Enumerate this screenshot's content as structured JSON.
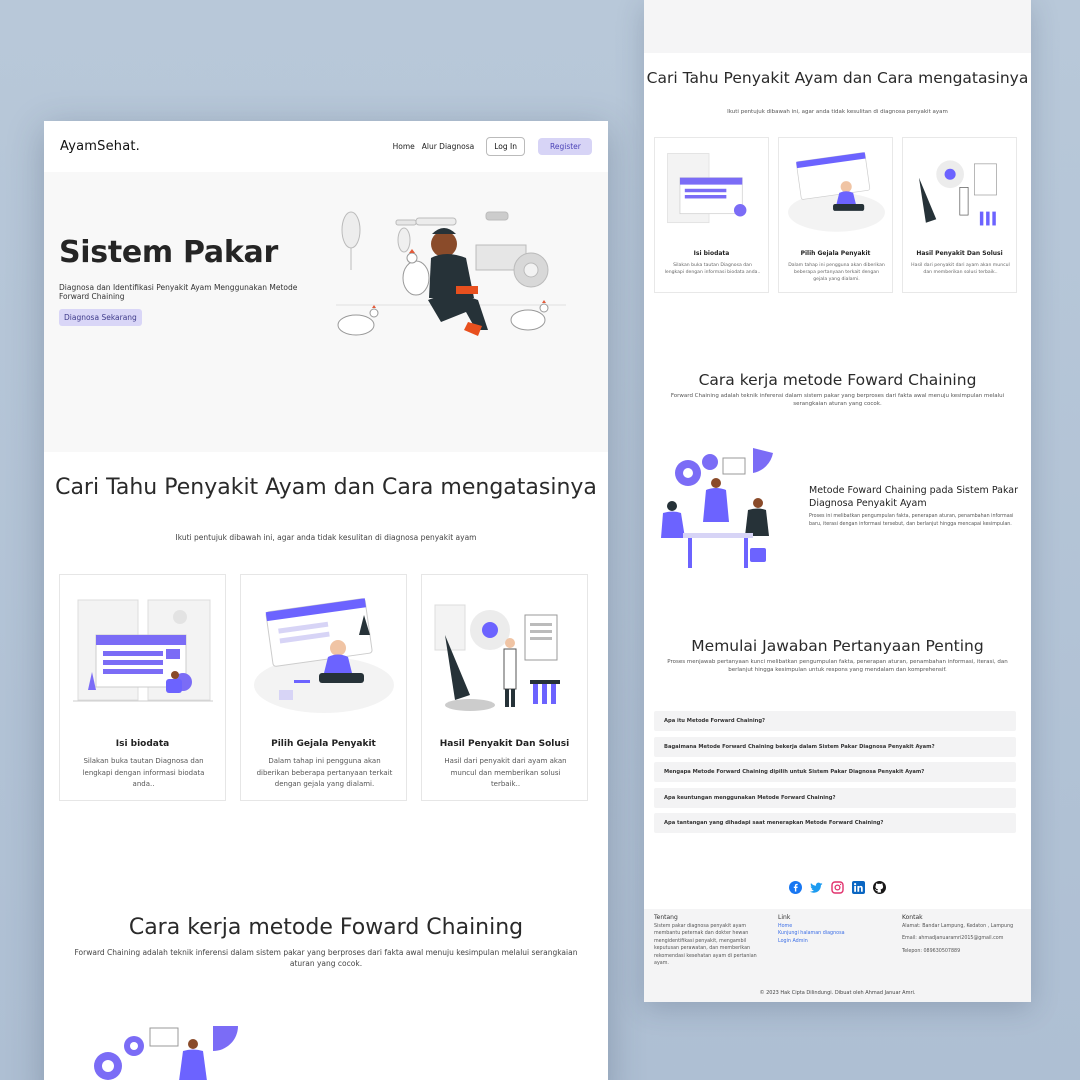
{
  "nav": {
    "brand": "AyamSehat.",
    "home": "Home",
    "alur": "Alur Diagnosa",
    "login": "Log In",
    "register": "Register"
  },
  "hero": {
    "title": "Sistem Pakar",
    "description": "Diagnosa dan Identifikasi Penyakit Ayam Menggunakan Metode Forward Chaining",
    "cta": "Diagnosa Sekarang"
  },
  "steps": {
    "title": "Cari Tahu Penyakit Ayam dan Cara mengatasinya",
    "subtitle": "Ikuti pentujuk dibawah ini, agar anda tidak kesulitan di diagnosa penyakit ayam",
    "cards": [
      {
        "title": "Isi biodata",
        "desc": "Silakan buka tautan Diagnosa dan lengkapi dengan informasi biodata anda.."
      },
      {
        "title": "Pilih Gejala Penyakit",
        "desc": "Dalam tahap ini pengguna akan diberikan beberapa pertanyaan terkait dengan gejala yang dialami."
      },
      {
        "title": "Hasil Penyakit Dan Solusi",
        "desc": "Hasil dari penyakit dari ayam akan muncul dan memberikan solusi terbaik.."
      }
    ]
  },
  "method": {
    "title": "Cara kerja metode Foward Chaining",
    "subtitle": "Forward Chaining adalah teknik inferensi dalam sistem pakar yang berproses dari fakta awal menuju kesimpulan melalui serangkaian aturan yang cocok.",
    "feature_title": "Metode Foward Chaining pada Sistem Pakar Diagnosa Penyakit Ayam",
    "feature_desc": "Proses ini melibatkan pengumpulan fakta, penerapan aturan, penambahan informasi baru, iterasi dengan informasi tersebut, dan berlanjut hingga mencapai kesimpulan."
  },
  "faq": {
    "title": "Memulai Jawaban Pertanyaan Penting",
    "subtitle": "Proses menjawab pertanyaan kunci melibatkan pengumpulan fakta, penerapan aturan, penambahan informasi, iterasi, dan berlanjut hingga kesimpulan untuk respons yang mendalam dan komprehensif.",
    "items": [
      "Apa itu Metode Forward Chaining?",
      "Bagaimana Metode Forward Chaining bekerja dalam Sistem Pakar Diagnosa Penyakit Ayam?",
      "Mengapa Metode Forward Chaining dipilih untuk Sistem Pakar Diagnosa Penyakit Ayam?",
      "Apa keuntungan menggunakan Metode Forward Chaining?",
      "Apa tantangan yang dihadapi saat menerapkan Metode Forward Chaining?"
    ]
  },
  "socials": [
    "facebook-icon",
    "twitter-icon",
    "instagram-icon",
    "linkedin-icon",
    "github-icon"
  ],
  "footer": {
    "about_head": "Tentang",
    "about_text": "Sistem pakar diagnosa penyakit ayam membantu peternak dan dokter hewan mengidentifikasi penyakit, mengambil keputusan perawatan, dan memberikan rekomendasi kesehatan ayam di pertanian ayam.",
    "link_head": "Link",
    "links": [
      "Home",
      "Kunjungi halaman diagnosa",
      "Login Admin"
    ],
    "contact_head": "Kontak",
    "address": "Alamat: Bandar Lampung, Kedaton , Lampung",
    "email": "Email: ahmadjanuaramri2015@gmail.com",
    "phone": "Telepon: 089630507889",
    "copyright": "© 2023 Hak Cipta Dilindungi. Dibuat oleh Ahmad Januar Amri."
  },
  "colors": {
    "accent": "#6c63ff",
    "accent_soft": "#d7d4f6",
    "dark": "#263238"
  }
}
